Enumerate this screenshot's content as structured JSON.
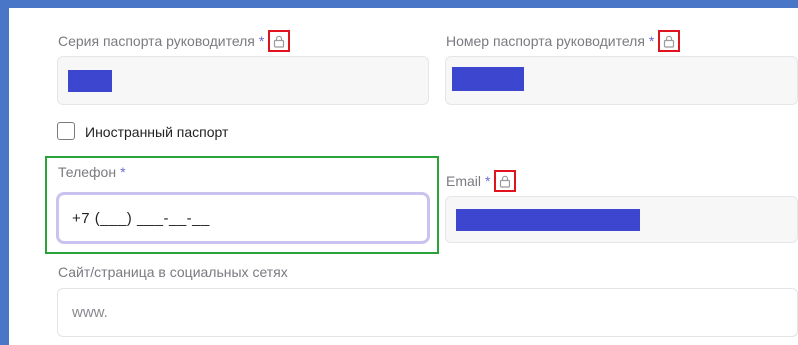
{
  "form": {
    "passport_series": {
      "label": "Серия паспорта руководителя",
      "required_mark": "*",
      "icon": "lock-icon"
    },
    "passport_number": {
      "label": "Номер паспорта руководителя",
      "required_mark": "*",
      "icon": "lock-icon"
    },
    "foreign_passport": {
      "label": "Иностранный паспорт",
      "checked": false
    },
    "phone": {
      "label": "Телефон",
      "required_mark": "*",
      "value": "+7 (___) ___-__-__"
    },
    "email": {
      "label": "Email",
      "required_mark": "*",
      "icon": "lock-icon"
    },
    "website": {
      "label": "Сайт/страница в социальных сетях",
      "placeholder": "www."
    }
  },
  "colors": {
    "frame": "#4a76c7",
    "redaction": "#3d46cf",
    "lock_highlight": "#e0141e",
    "field_highlight": "#29a33a",
    "focus_border": "#c9c3ef"
  }
}
